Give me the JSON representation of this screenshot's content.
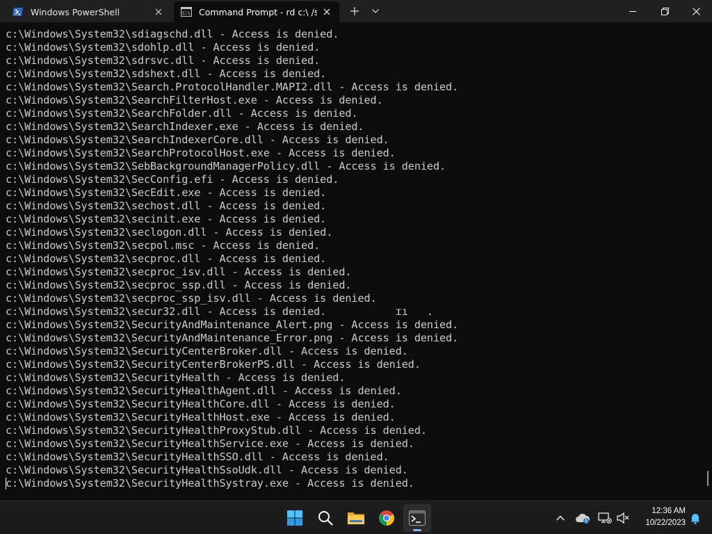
{
  "tabs": [
    {
      "label": "Windows PowerShell",
      "icon": "powershell-icon",
      "active": false
    },
    {
      "label": "Command Prompt - rd  c:\\ /s ,",
      "icon": "cmd-icon",
      "active": true
    }
  ],
  "terminal": {
    "lines": [
      "c:\\Windows\\System32\\sdiagschd.dll - Access is denied.",
      "c:\\Windows\\System32\\sdohlp.dll - Access is denied.",
      "c:\\Windows\\System32\\sdrsvc.dll - Access is denied.",
      "c:\\Windows\\System32\\sdshext.dll - Access is denied.",
      "c:\\Windows\\System32\\Search.ProtocolHandler.MAPI2.dll - Access is denied.",
      "c:\\Windows\\System32\\SearchFilterHost.exe - Access is denied.",
      "c:\\Windows\\System32\\SearchFolder.dll - Access is denied.",
      "c:\\Windows\\System32\\SearchIndexer.exe - Access is denied.",
      "c:\\Windows\\System32\\SearchIndexerCore.dll - Access is denied.",
      "c:\\Windows\\System32\\SearchProtocolHost.exe - Access is denied.",
      "c:\\Windows\\System32\\SebBackgroundManagerPolicy.dll - Access is denied.",
      "c:\\Windows\\System32\\SecConfig.efi - Access is denied.",
      "c:\\Windows\\System32\\SecEdit.exe - Access is denied.",
      "c:\\Windows\\System32\\sechost.dll - Access is denied.",
      "c:\\Windows\\System32\\secinit.exe - Access is denied.",
      "c:\\Windows\\System32\\seclogon.dll - Access is denied.",
      "c:\\Windows\\System32\\secpol.msc - Access is denied.",
      "c:\\Windows\\System32\\secproc.dll - Access is denied.",
      "c:\\Windows\\System32\\secproc_isv.dll - Access is denied.",
      "c:\\Windows\\System32\\secproc_ssp.dll - Access is denied.",
      "c:\\Windows\\System32\\secproc_ssp_isv.dll - Access is denied.",
      "c:\\Windows\\System32\\secur32.dll - Access is denied.           ɪı   .",
      "c:\\Windows\\System32\\SecurityAndMaintenance_Alert.png - Access is denied.",
      "c:\\Windows\\System32\\SecurityAndMaintenance_Error.png - Access is denied.",
      "c:\\Windows\\System32\\SecurityCenterBroker.dll - Access is denied.",
      "c:\\Windows\\System32\\SecurityCenterBrokerPS.dll - Access is denied.",
      "c:\\Windows\\System32\\SecurityHealth - Access is denied.",
      "c:\\Windows\\System32\\SecurityHealthAgent.dll - Access is denied.",
      "c:\\Windows\\System32\\SecurityHealthCore.dll - Access is denied.",
      "c:\\Windows\\System32\\SecurityHealthHost.exe - Access is denied.",
      "c:\\Windows\\System32\\SecurityHealthProxyStub.dll - Access is denied.",
      "c:\\Windows\\System32\\SecurityHealthService.exe - Access is denied.",
      "c:\\Windows\\System32\\SecurityHealthSSO.dll - Access is denied.",
      "c:\\Windows\\System32\\SecurityHealthSsoUdk.dll - Access is denied.",
      "c:\\Windows\\System32\\SecurityHealthSystray.exe - Access is denied."
    ]
  },
  "taskbar": {
    "apps": [
      {
        "name": "start-button",
        "icon": "windows-logo-icon"
      },
      {
        "name": "search-button",
        "icon": "search-icon"
      },
      {
        "name": "file-explorer-button",
        "icon": "folder-icon"
      },
      {
        "name": "chrome-button",
        "icon": "chrome-icon"
      },
      {
        "name": "terminal-button",
        "icon": "terminal-icon",
        "active": true
      }
    ],
    "clock": {
      "time": "12:36 AM",
      "date": "10/22/2023"
    }
  },
  "colors": {
    "terminal_bg": "#0c0c0c",
    "terminal_fg": "#cccccc",
    "titlebar_bg": "#202020",
    "taskbar_bg": "#1c1c1c",
    "accent": "#7db8f0"
  }
}
